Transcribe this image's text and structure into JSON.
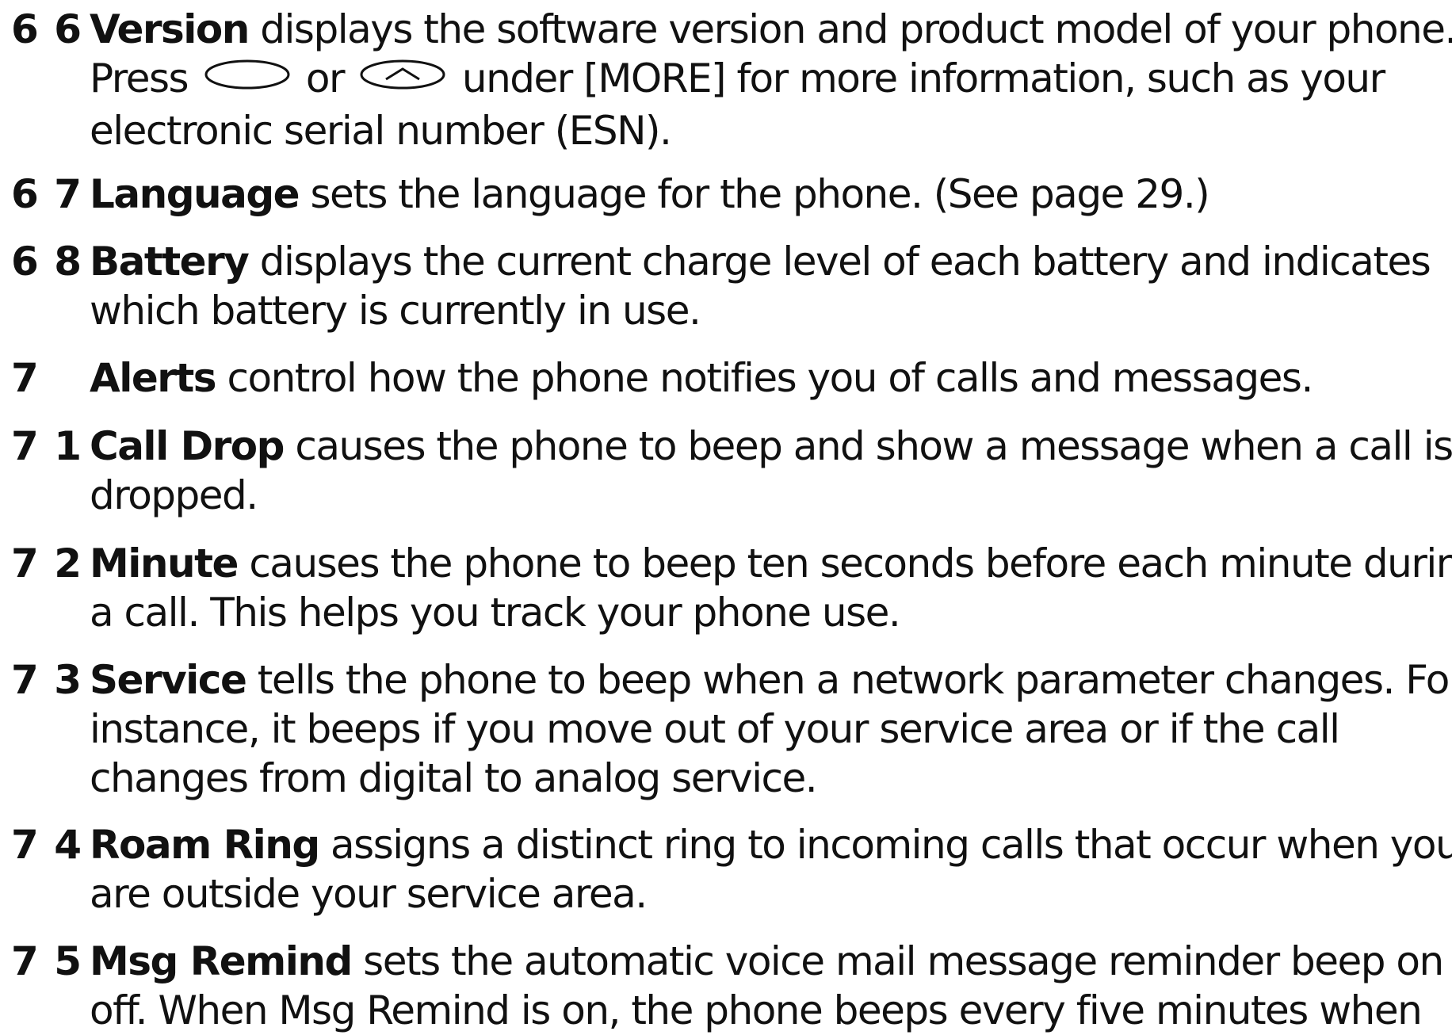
{
  "entries": [
    {
      "number": "6 6",
      "term": "Version",
      "line1": "displays the software version and product model of your phone.",
      "line2_pre": "Press",
      "line2_mid": "or",
      "line2_post": "under [MORE] for more information, such as your",
      "line3": "electronic serial number (ESN).",
      "key_icons": [
        "blank-soft-key-icon",
        "up-arrow-key-icon"
      ]
    },
    {
      "number": "6 7",
      "term": "Language",
      "line1": "sets the language for the phone. (See page 29.)"
    },
    {
      "number": "6 8",
      "term": "Battery",
      "line1": "displays the current charge level of each battery and indicates",
      "line2": "which battery is currently in use."
    },
    {
      "number": "7",
      "term": "Alerts",
      "line1": "control how the phone notifies you of calls and messages."
    },
    {
      "number": "7 1",
      "term": "Call Drop",
      "line1": "causes the phone to beep and show a message when a call is",
      "line2": "dropped."
    },
    {
      "number": "7 2",
      "term": "Minute",
      "line1": "causes the phone to beep ten seconds before each minute during",
      "line2": "a call. This helps you track your phone use."
    },
    {
      "number": "7 3",
      "term": "Service",
      "line1": "tells the phone to beep when a network parameter changes. For",
      "line2": "instance, it beeps if you move out of your service area or if the call",
      "line3": "changes from digital to analog service."
    },
    {
      "number": "7 4",
      "term": "Roam Ring",
      "line1": "assigns a distinct ring to incoming calls that occur when you",
      "line2": "are outside your service area."
    },
    {
      "number": "7 5",
      "term": "Msg Remind",
      "line1": "sets the automatic voice mail message reminder beep on or",
      "line2": "off. When Msg Remind is on, the phone beeps every five minutes when"
    }
  ]
}
